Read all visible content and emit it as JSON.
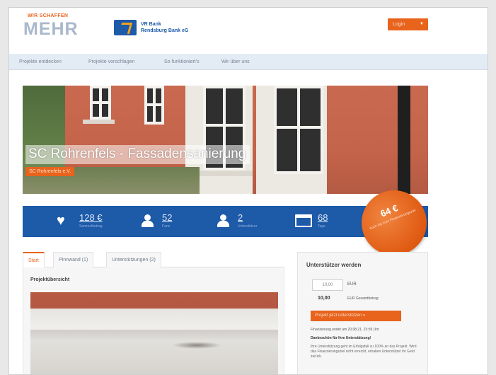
{
  "header": {
    "brand_tagline": "WIR SCHAFFEN",
    "brand": "MEHR",
    "bank_name_line1": "VR Bank",
    "bank_name_line2": "Rendsburg Bank eG",
    "login_label": "Login",
    "login_icon": "chevron-down-icon"
  },
  "nav": {
    "items": [
      {
        "label": "Projekte entdecken"
      },
      {
        "label": "Projekte vorschlagen"
      },
      {
        "label": "So funktioniert's"
      },
      {
        "label": "Wir über uns"
      }
    ]
  },
  "hero": {
    "title": "SC Rohrenfels - Fassadensanierung",
    "subtitle": "SC Rohrenfels e.V."
  },
  "stats": [
    {
      "icon": "heart-icon",
      "value": "128 €",
      "label": "Sammelbetrag"
    },
    {
      "icon": "person-icon",
      "value": "52",
      "label": "Fans"
    },
    {
      "icon": "person-icon",
      "value": "2",
      "label": "Unterstützer"
    },
    {
      "icon": "calendar-icon",
      "value": "68",
      "label": "Tage"
    }
  ],
  "badge": {
    "amount": "64 €",
    "text": "noch bis zum Finanzierungsziel"
  },
  "tabs": [
    {
      "label": "Start",
      "active": true
    },
    {
      "label": "Pinnwand (1)",
      "active": false
    },
    {
      "label": "Unterstützungen (2)",
      "active": false
    }
  ],
  "content": {
    "overview_label": "Projektübersicht"
  },
  "sidebar": {
    "title": "Unterstützer werden",
    "amount_value": "10,00",
    "amount_unit": "EUR",
    "total_value": "10,00",
    "total_label": "EUR Gesamtbetrag",
    "support_button": "Projekt jetzt unterstützen »",
    "note": "Finanzierung endet am 20.08.21, 23:59 Uhr",
    "heading": "Dankeschön für Ihre Unterstützung!",
    "paragraph": "Ihre Unterstützung geht im Erfolgsfall zu 100% an das Projekt. Wird das Finanzierungsziel nicht erreicht, erhalten Unterstützer ihr Geld zurück."
  },
  "colors": {
    "accent_orange": "#e8631c",
    "brand_blue": "#1d5aa8",
    "nav_bg": "#e3ebf5"
  }
}
